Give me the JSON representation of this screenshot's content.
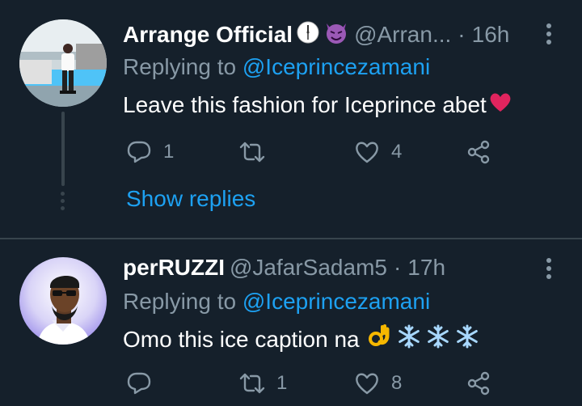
{
  "tweets": [
    {
      "name": "Arrange Official",
      "name_emojis": [
        "clock-icon",
        "smiling-imp-icon"
      ],
      "handle": "@Arran...",
      "separator": "·",
      "time": "16h",
      "replying_label": "Replying to",
      "replying_to": "@Iceprincezamani",
      "text": "Leave this fashion for Iceprince abet",
      "text_emojis": [
        "red-heart-icon"
      ],
      "reply_count": "1",
      "retweet_count": "",
      "like_count": "4",
      "show_replies": "Show replies"
    },
    {
      "name": "perRUZZI",
      "handle": "@JafarSadam5",
      "separator": "·",
      "time": "17h",
      "replying_label": "Replying to",
      "replying_to": "@Iceprincezamani",
      "text": "Omo this ice caption na",
      "text_emojis": [
        "ok-hand-icon",
        "snowflake-icon",
        "snowflake-icon",
        "snowflake-icon"
      ],
      "reply_count": "",
      "retweet_count": "1",
      "like_count": "8"
    }
  ],
  "colors": {
    "background": "#15202b",
    "divider": "#38444d",
    "secondary_text": "#8899a6",
    "link": "#1da1f2",
    "primary_text": "#ffffff"
  }
}
